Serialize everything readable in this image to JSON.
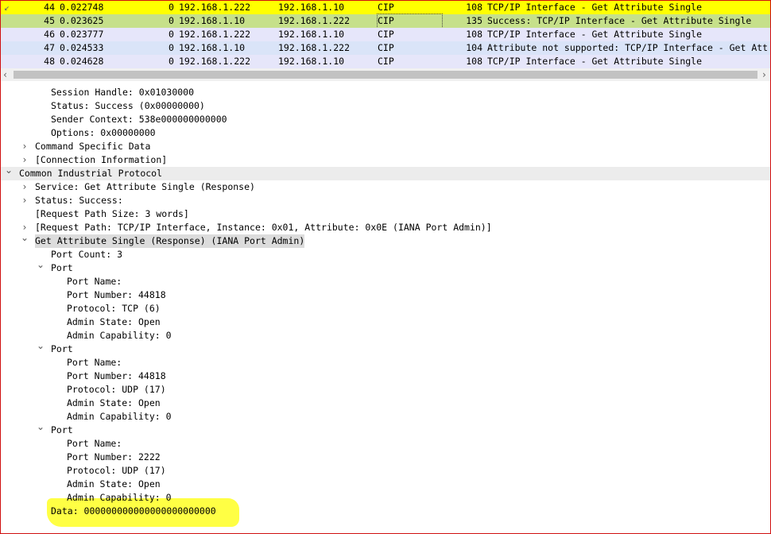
{
  "packets": [
    {
      "no": "44",
      "time": "0.022748",
      "src_prefix": "0",
      "src": "192.168.1.222",
      "dst": "192.168.1.10",
      "proto": "CIP",
      "len": "108",
      "info": "TCP/IP Interface - Get Attribute Single",
      "bg": "#ffff00",
      "mark": "↙"
    },
    {
      "no": "45",
      "time": "0.023625",
      "src_prefix": "0",
      "src": "192.168.1.10",
      "dst": "192.168.1.222",
      "proto": "CIP",
      "len": "135",
      "info": "Success: TCP/IP Interface - Get Attribute Single",
      "bg": "#c6e08a",
      "mark": "",
      "selected": true
    },
    {
      "no": "46",
      "time": "0.023777",
      "src_prefix": "0",
      "src": "192.168.1.222",
      "dst": "192.168.1.10",
      "proto": "CIP",
      "len": "108",
      "info": "TCP/IP Interface - Get Attribute Single",
      "bg": "#e6e6fa",
      "mark": ""
    },
    {
      "no": "47",
      "time": "0.024533",
      "src_prefix": "0",
      "src": "192.168.1.10",
      "dst": "192.168.1.222",
      "proto": "CIP",
      "len": "104",
      "info": "Attribute not supported: TCP/IP Interface - Get Att",
      "bg": "#dae4f8",
      "mark": ""
    },
    {
      "no": "48",
      "time": "0.024628",
      "src_prefix": "0",
      "src": "192.168.1.222",
      "dst": "192.168.1.10",
      "proto": "CIP",
      "len": "108",
      "info": "TCP/IP Interface - Get Attribute Single",
      "bg": "#e6e6fa",
      "mark": ""
    }
  ],
  "tree": [
    {
      "indent": 3,
      "toggle": "",
      "text": "Session Handle: 0x01030000"
    },
    {
      "indent": 3,
      "toggle": "",
      "text": "Status: Success (0x00000000)"
    },
    {
      "indent": 3,
      "toggle": "",
      "text": "Sender Context: 538e000000000000"
    },
    {
      "indent": 3,
      "toggle": "",
      "text": "Options: 0x00000000"
    },
    {
      "indent": 2,
      "toggle": "collapsed",
      "text": "Command Specific Data"
    },
    {
      "indent": 2,
      "toggle": "collapsed",
      "text": "[Connection Information]"
    },
    {
      "indent": 1,
      "toggle": "expanded",
      "text": "Common Industrial Protocol",
      "style": "hlfull"
    },
    {
      "indent": 2,
      "toggle": "collapsed",
      "text": "Service: Get Attribute Single (Response)"
    },
    {
      "indent": 2,
      "toggle": "collapsed",
      "text": "Status: Success:"
    },
    {
      "indent": 2,
      "toggle": "",
      "text": "[Request Path Size: 3 words]"
    },
    {
      "indent": 2,
      "toggle": "collapsed",
      "text": "[Request Path: TCP/IP Interface, Instance: 0x01, Attribute: 0x0E (IANA Port Admin)]"
    },
    {
      "indent": 2,
      "toggle": "expanded",
      "text": "Get Attribute Single (Response) (IANA Port Admin)",
      "style": "hl"
    },
    {
      "indent": 3,
      "toggle": "",
      "text": "Port Count: 3"
    },
    {
      "indent": 3,
      "toggle": "expanded",
      "text": "Port"
    },
    {
      "indent": 4,
      "toggle": "",
      "text": "Port Name:"
    },
    {
      "indent": 4,
      "toggle": "",
      "text": "Port Number: 44818"
    },
    {
      "indent": 4,
      "toggle": "",
      "text": "Protocol: TCP (6)"
    },
    {
      "indent": 4,
      "toggle": "",
      "text": "Admin State: Open"
    },
    {
      "indent": 4,
      "toggle": "",
      "text": "Admin Capability: 0"
    },
    {
      "indent": 3,
      "toggle": "expanded",
      "text": "Port"
    },
    {
      "indent": 4,
      "toggle": "",
      "text": "Port Name:"
    },
    {
      "indent": 4,
      "toggle": "",
      "text": "Port Number: 44818"
    },
    {
      "indent": 4,
      "toggle": "",
      "text": "Protocol: UDP (17)"
    },
    {
      "indent": 4,
      "toggle": "",
      "text": "Admin State: Open"
    },
    {
      "indent": 4,
      "toggle": "",
      "text": "Admin Capability: 0"
    },
    {
      "indent": 3,
      "toggle": "expanded",
      "text": "Port"
    },
    {
      "indent": 4,
      "toggle": "",
      "text": "Port Name:"
    },
    {
      "indent": 4,
      "toggle": "",
      "text": "Port Number: 2222"
    },
    {
      "indent": 4,
      "toggle": "",
      "text": "Protocol: UDP (17)"
    },
    {
      "indent": 4,
      "toggle": "",
      "text": "Admin State: Open"
    },
    {
      "indent": 4,
      "toggle": "",
      "text": "Admin Capability: 0"
    },
    {
      "indent": 3,
      "toggle": "",
      "text": "Data: 000000000000000000000000"
    }
  ],
  "icons": {
    "collapsed": "chevron-right-icon",
    "expanded": "chevron-down-icon"
  },
  "colors": {
    "highlighter": "#ffff30",
    "border": "#d01010"
  }
}
